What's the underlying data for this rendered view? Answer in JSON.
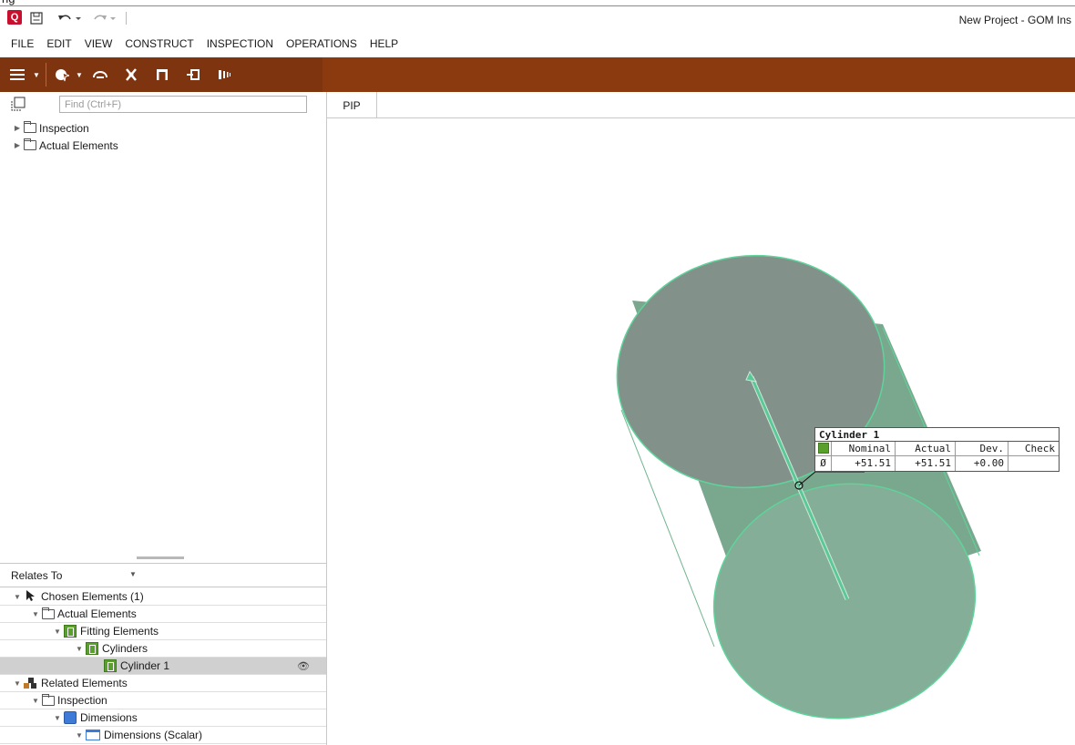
{
  "app": {
    "clipped_title": "ng",
    "window_title": "New Project - GOM Ins"
  },
  "menu": [
    "FILE",
    "EDIT",
    "VIEW",
    "CONSTRUCT",
    "INSPECTION",
    "OPERATIONS",
    "HELP"
  ],
  "search": {
    "placeholder": "Find (Ctrl+F)"
  },
  "explorer_tree": [
    {
      "label": "Inspection"
    },
    {
      "label": "Actual Elements"
    }
  ],
  "relates": {
    "label": "Relates To"
  },
  "relations_tree": {
    "chosen": "Chosen Elements (1)",
    "actual": "Actual Elements",
    "fitting": "Fitting Elements",
    "cylinders": "Cylinders",
    "cylinder1": "Cylinder 1",
    "related": "Related Elements",
    "inspection": "Inspection",
    "dimensions": "Dimensions",
    "dimensions_scalar": "Dimensions (Scalar)"
  },
  "viewport": {
    "tab": "PIP"
  },
  "label": {
    "title": "Cylinder 1",
    "headers": [
      "Nominal",
      "Actual",
      "Dev.",
      "Check"
    ],
    "row": {
      "symbol": "Ø",
      "nominal": "+51.51",
      "actual": "+51.51",
      "dev": "+0.00",
      "check": ""
    }
  },
  "colors": {
    "toolbar": "#8b3a0f",
    "cylinder": "#7aa88f",
    "cylinder_outline": "#5fd39a",
    "selected_row": "#d0d0d0"
  }
}
